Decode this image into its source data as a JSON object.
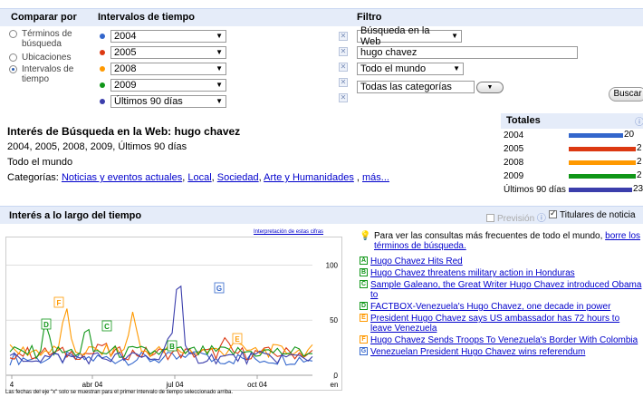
{
  "header": {
    "compare_by": "Comparar por",
    "time_ranges": "Intervalos de tiempo",
    "filter": "Filtro"
  },
  "compare_options": [
    {
      "label": "Términos de búsqueda",
      "checked": false
    },
    {
      "label": "Ubicaciones",
      "checked": false
    },
    {
      "label": "Intervalos de tiempo",
      "checked": true
    }
  ],
  "time_ranges": [
    {
      "label": "2004",
      "color": "#3366cc"
    },
    {
      "label": "2005",
      "color": "#dc3912"
    },
    {
      "label": "2008",
      "color": "#ff9900"
    },
    {
      "label": "2009",
      "color": "#109618"
    },
    {
      "label": "Últimos 90 días",
      "color": "#3b3eac"
    }
  ],
  "filters": {
    "search_type": "Búsqueda en la Web",
    "query": "hugo chavez",
    "region": "Todo el mundo",
    "category": "Todas las categorías",
    "search_button": "Buscar"
  },
  "summary": {
    "title": "Interés de Búsqueda en la Web: hugo chavez",
    "periods": "2004, 2005, 2008, 2009, Últimos 90 días",
    "region": "Todo el mundo",
    "categories_label": "Categorías:",
    "categories": [
      "Noticias y eventos actuales",
      "Local",
      "Sociedad",
      "Arte y Humanidades"
    ],
    "more": "más..."
  },
  "totals": {
    "title": "Totales",
    "rows": [
      {
        "name": "2004",
        "value": "20",
        "fraction": 0.87,
        "color": "#3366cc"
      },
      {
        "name": "2005",
        "value": "2",
        "fraction": 0.98,
        "color": "#dc3912"
      },
      {
        "name": "2008",
        "value": "2",
        "fraction": 0.98,
        "color": "#ff9900"
      },
      {
        "name": "2009",
        "value": "2",
        "fraction": 0.98,
        "color": "#109618"
      },
      {
        "name": "Últimos 90 días",
        "value": "23",
        "fraction": 1.0,
        "color": "#3b3eac"
      }
    ]
  },
  "section": {
    "title": "Interés a lo largo del tiempo",
    "forecast": "Previsión",
    "news_headlines": "Titulares de noticia"
  },
  "chart_data": {
    "type": "line",
    "link": "Interpretación de estas cifras",
    "note": "Las fechas del eje \"x\" solo se muestran para el primer intervalo de tiempo seleccionado arriba.",
    "x_tick_labels": [
      "4",
      "abr 04",
      "jul 04",
      "oct 04",
      "en"
    ],
    "y_tick_labels": [
      "0",
      "50",
      "100"
    ],
    "ylim": [
      0,
      120
    ],
    "series_colors": [
      "#3366cc",
      "#dc3912",
      "#ff9900",
      "#109618",
      "#3b3eac"
    ],
    "markers": [
      {
        "letter": "D",
        "color": "#109618"
      },
      {
        "letter": "F",
        "color": "#ff9900"
      },
      {
        "letter": "C",
        "color": "#109618"
      },
      {
        "letter": "B",
        "color": "#109618"
      },
      {
        "letter": "G",
        "color": "#3366cc"
      },
      {
        "letter": "E",
        "color": "#ff9900"
      }
    ]
  },
  "hint": {
    "text": "Para ver las consultas más frecuentes de todo el mundo, ",
    "link": "borre los términos de búsqueda."
  },
  "news": [
    {
      "letter": "A",
      "color": "#109618",
      "text": "Hugo Chavez Hits Red"
    },
    {
      "letter": "B",
      "color": "#109618",
      "text": "Hugo Chavez threatens military action in Honduras"
    },
    {
      "letter": "C",
      "color": "#109618",
      "text": "Sample Galeano, the Great Writer Hugo Chavez introduced Obama to"
    },
    {
      "letter": "D",
      "color": "#109618",
      "text": "FACTBOX-Venezuela's Hugo Chavez, one decade in power"
    },
    {
      "letter": "E",
      "color": "#ff9900",
      "text": "President Hugo Chavez says US ambassador has 72 hours to leave Venezuela"
    },
    {
      "letter": "F",
      "color": "#ff9900",
      "text": "Hugo Chavez Sends Troops To Venezuela's Border With Colombia"
    },
    {
      "letter": "G",
      "color": "#3366cc",
      "text": "Venezuelan President Hugo Chavez wins referendum"
    }
  ]
}
